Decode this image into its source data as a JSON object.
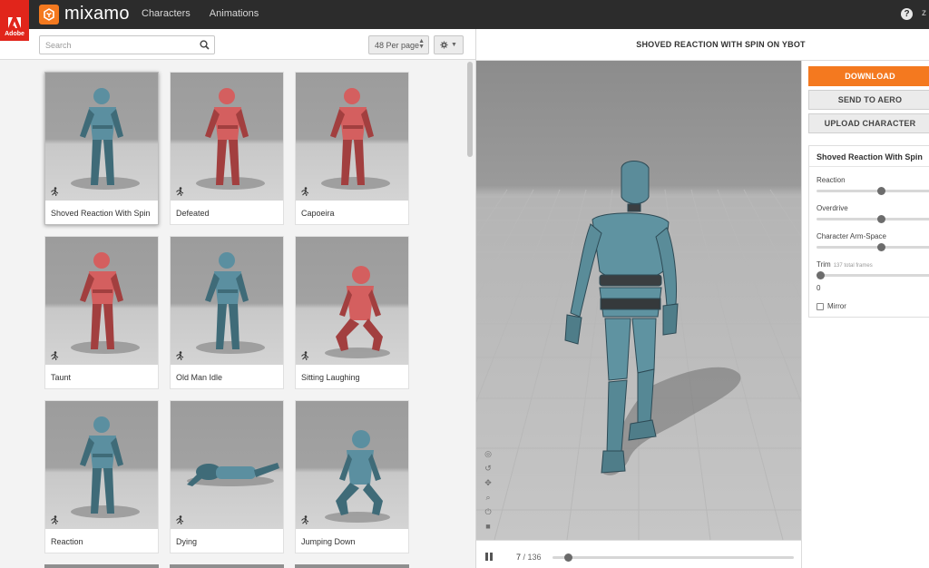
{
  "app": {
    "brand": "mixamo",
    "adobe_label": "Adobe",
    "nav": [
      "Characters",
      "Animations"
    ],
    "user_initial": "z",
    "colors": {
      "accent": "#f4791f",
      "adobe_red": "#e1251b",
      "topbar": "#2c2c2c"
    }
  },
  "search": {
    "placeholder": "Search",
    "value": ""
  },
  "toolbar": {
    "per_page": "48 Per page",
    "settings_icon": "gear-icon"
  },
  "animations": [
    {
      "label": "Shoved Reaction With Spin",
      "color": "blue",
      "selected": true
    },
    {
      "label": "Defeated",
      "color": "red",
      "selected": false
    },
    {
      "label": "Capoeira",
      "color": "red",
      "selected": false
    },
    {
      "label": "Taunt",
      "color": "red",
      "selected": false
    },
    {
      "label": "Old Man Idle",
      "color": "blue",
      "selected": false
    },
    {
      "label": "Sitting Laughing",
      "color": "red",
      "selected": false
    },
    {
      "label": "Reaction",
      "color": "blue",
      "selected": false
    },
    {
      "label": "Dying",
      "color": "blue",
      "selected": false
    },
    {
      "label": "Jumping Down",
      "color": "blue",
      "selected": false
    }
  ],
  "viewer": {
    "title": "SHOVED REACTION WITH SPIN ON YBOT",
    "current_frame": "7",
    "total_frames": "136",
    "progress": 0.05
  },
  "actions": {
    "download": "DOWNLOAD",
    "send_to_aero": "SEND TO AERO",
    "upload_character": "UPLOAD CHARACTER"
  },
  "settings": {
    "title": "Shoved Reaction With Spin",
    "params": [
      {
        "label": "Reaction",
        "level": 0.55
      },
      {
        "label": "Overdrive",
        "level": 0.55
      },
      {
        "label": "Character Arm-Space",
        "level": 0.55
      }
    ],
    "trim": {
      "label": "Trim",
      "sub": "137 total frames",
      "value": "0",
      "level": 0
    },
    "mirror": {
      "label": "Mirror",
      "checked": false
    }
  }
}
